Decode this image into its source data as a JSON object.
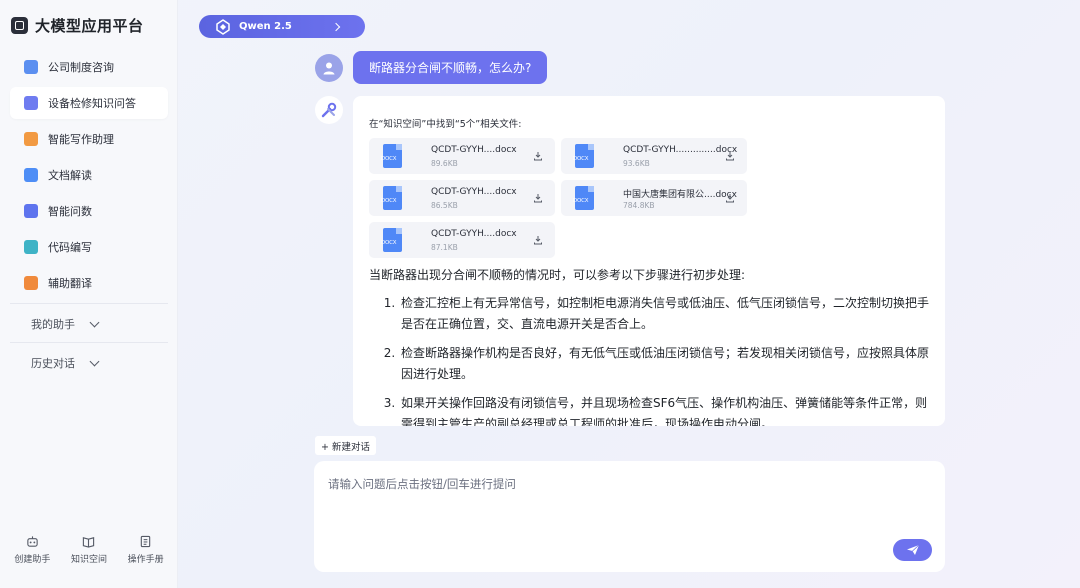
{
  "app": {
    "title": "大模型应用平台"
  },
  "sidebar": {
    "items": [
      {
        "label": "公司制度咨询",
        "icon": "policy-icon",
        "color": "#5b8ff0"
      },
      {
        "label": "设备检修知识问答",
        "icon": "tools-icon",
        "color": "#6f7cf0"
      },
      {
        "label": "智能写作助理",
        "icon": "writing-icon",
        "color": "#f29a42"
      },
      {
        "label": "文档解读",
        "icon": "document-icon",
        "color": "#4e8ef6"
      },
      {
        "label": "智能问数",
        "icon": "data-chart-icon",
        "color": "#5e74ee"
      },
      {
        "label": "代码编写",
        "icon": "code-icon",
        "color": "#3fb3c6"
      },
      {
        "label": "辅助翻译",
        "icon": "translate-icon",
        "color": "#f08a3c"
      }
    ],
    "active_index": 1,
    "groups": [
      {
        "label": "我的助手"
      },
      {
        "label": "历史对话"
      }
    ],
    "bottom": [
      {
        "label": "创建助手",
        "icon": "robot-icon"
      },
      {
        "label": "知识空间",
        "icon": "book-icon"
      },
      {
        "label": "操作手册",
        "icon": "manual-icon"
      }
    ]
  },
  "model": {
    "name": "Qwen 2.5"
  },
  "chat": {
    "user_message": "断路器分合闸不顺畅，怎么办?",
    "found_line": "在“知识空间”中找到“5个”相关文件:",
    "files": [
      {
        "name": "QCDT-GYYH....docx",
        "size": "89.6KB",
        "type": "DOCX"
      },
      {
        "name": "QCDT-GYYH..............docx",
        "size": "93.6KB",
        "type": "DOCX"
      },
      {
        "name": "QCDT-GYYH....docx",
        "size": "86.5KB",
        "type": "DOCX"
      },
      {
        "name": "中国大唐集团有限公....docx",
        "size": "784.8KB",
        "type": "DOCX"
      },
      {
        "name": "QCDT-GYYH....docx",
        "size": "87.1KB",
        "type": "DOCX"
      }
    ],
    "intro": "当断路器出现分合闸不顺畅的情况时，可以参考以下步骤进行初步处理:",
    "steps": [
      "检查汇控柜上有无异常信号，如控制柜电源消失信号或低油压、低气压闭锁信号，二次控制切换把手是否在正确位置，交、直流电源开关是否合上。",
      "检查断路器操作机构是否良好，有无低气压或低油压闭锁信号；若发现相关闭锁信号，应按照具体原因进行处理。",
      "如果开关操作回路没有闭锁信号，并且现场检查SF6气压、操作机构油压、弹簧储能等条件正常，则需得到主管生产的副总经理或总工程师的批准后，现场操作电动分闸。"
    ],
    "new_chat_label": "+ 新建对话"
  },
  "input": {
    "placeholder": "请输入问题后点击按钮/回车进行提问",
    "value": ""
  },
  "colors": {
    "accent": "#6d72ee",
    "file_icon": "#4f88f7"
  }
}
